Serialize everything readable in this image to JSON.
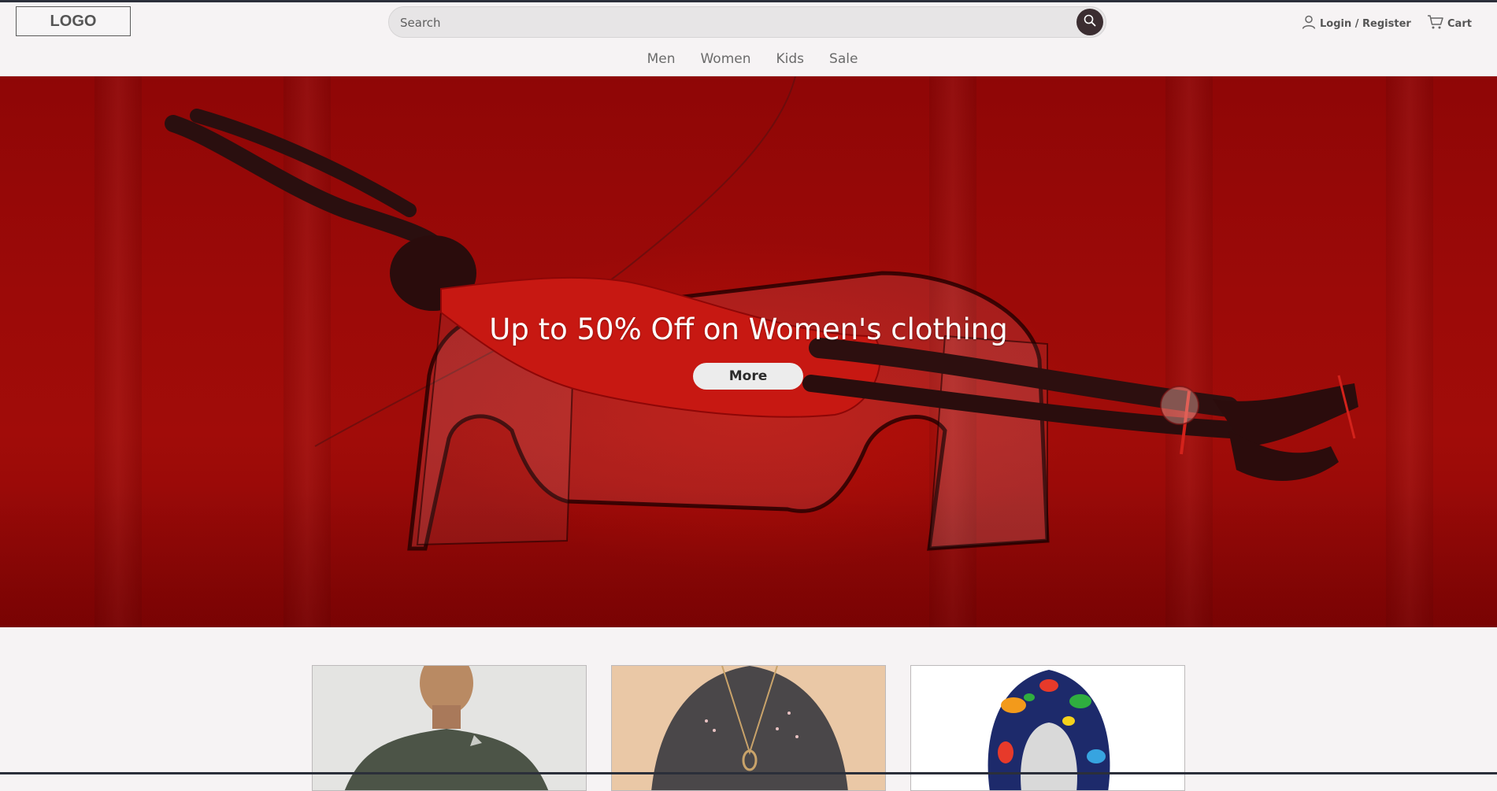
{
  "brand": {
    "logo_text": "LOGO"
  },
  "search": {
    "placeholder": "Search",
    "value": ""
  },
  "account": {
    "label": "Login / Register",
    "icon": "user-icon"
  },
  "cart": {
    "label": "Cart",
    "icon": "cart-icon"
  },
  "nav": {
    "items": [
      {
        "label": "Men"
      },
      {
        "label": "Women"
      },
      {
        "label": "Kids"
      },
      {
        "label": "Sale"
      }
    ]
  },
  "hero": {
    "title": "Up to 50% Off on Women's clothing",
    "button_label": "More",
    "background_color": "#9c0a08"
  },
  "products": {
    "cards": [
      {
        "image": "man-in-olive-long-sleeve-shirt"
      },
      {
        "image": "woman-in-grey-sweater"
      },
      {
        "image": "dinosaur-print-hoodie"
      }
    ]
  },
  "colors": {
    "accent_dark": "#3b2d31",
    "page_bg": "#f6f3f4"
  }
}
